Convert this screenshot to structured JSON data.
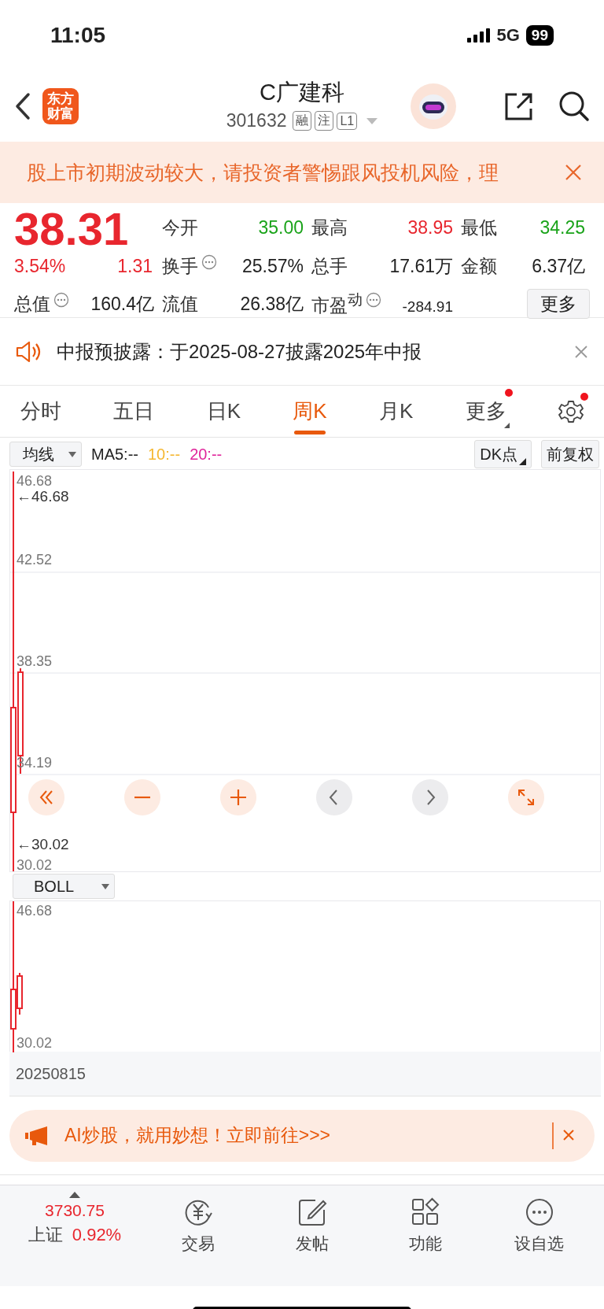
{
  "status_bar": {
    "time": "11:05",
    "network": "5G",
    "battery": "99"
  },
  "header": {
    "logo_text": [
      "东方",
      "财富"
    ],
    "title": "C广建科",
    "code": "301632",
    "tags": [
      "融",
      "注",
      "L1"
    ]
  },
  "risk_banner": {
    "text": "股上市初期波动较大，请投资者警惕跟风投机风险，理"
  },
  "quote": {
    "price": "38.31",
    "change_pct": "3.54%",
    "change": "1.31",
    "color": "#e8262e",
    "stats": [
      {
        "label": "今开",
        "value": "35.00",
        "color": "#1aa31a"
      },
      {
        "label": "最高",
        "value": "38.95",
        "color": "#e8262e"
      },
      {
        "label": "最低",
        "value": "34.25",
        "color": "#1aa31a"
      },
      {
        "label": "换手",
        "value": "25.57%",
        "color": "#222222",
        "info": true
      },
      {
        "label": "总手",
        "value": "17.61万",
        "color": "#222222"
      },
      {
        "label": "金额",
        "value": "6.37亿",
        "color": "#222222"
      },
      {
        "label": "总值",
        "value": "160.4亿",
        "color": "#222222",
        "info": true
      },
      {
        "label": "流值",
        "value": "26.38亿",
        "color": "#222222"
      },
      {
        "label": "市盈$^{动}$",
        "value": "-284.91",
        "color": "#222222",
        "info": true,
        "compact": true
      }
    ],
    "more_button": "更多"
  },
  "notice": {
    "text": "中报预披露：于2025-08-27披露2025年中报"
  },
  "tabs": [
    {
      "label": "分时",
      "selected": false,
      "dot": false
    },
    {
      "label": "五日",
      "selected": false,
      "dot": false
    },
    {
      "label": "日K",
      "selected": false,
      "dot": false
    },
    {
      "label": "周K",
      "selected": true,
      "dot": false
    },
    {
      "label": "月K",
      "selected": false,
      "dot": false
    },
    {
      "label": "更多",
      "selected": false,
      "dot": true
    }
  ],
  "settings_dot": true,
  "chart_toolbar": {
    "indicator_select": "均线",
    "ma": [
      {
        "label": "MA5:--",
        "color": "#222222"
      },
      {
        "label": "10:--",
        "color": "#f5b731"
      },
      {
        "label": "20:--",
        "color": "#e0249a"
      }
    ],
    "dk_button": "DK点",
    "adjust_button": "前复权"
  },
  "main_chart": {
    "y_labels": [
      "46.68",
      "42.52",
      "38.35",
      "34.19",
      "30.02"
    ],
    "max_marker": "←46.68",
    "min_marker": "←30.02",
    "controls": [
      {
        "kind": "rewind"
      },
      {
        "kind": "zoom-out"
      },
      {
        "kind": "zoom-in"
      },
      {
        "kind": "prev"
      },
      {
        "kind": "next"
      },
      {
        "kind": "expand"
      }
    ]
  },
  "sub_chart": {
    "indicator_select": "BOLL",
    "y_labels": [
      "46.68",
      "30.02"
    ],
    "date": "20250815"
  },
  "ai_banner": {
    "text": "AI炒股，就用妙想！立即前往>>>"
  },
  "bottom_bar": {
    "index": {
      "value": "3730.75",
      "name": "上证",
      "change": "0.92%",
      "color": "#e8262e"
    },
    "items": [
      {
        "kind": "trade",
        "label": "交易"
      },
      {
        "kind": "post",
        "label": "发帖"
      },
      {
        "kind": "functions",
        "label": "功能"
      },
      {
        "kind": "watchlist",
        "label": "设自选"
      }
    ]
  }
}
